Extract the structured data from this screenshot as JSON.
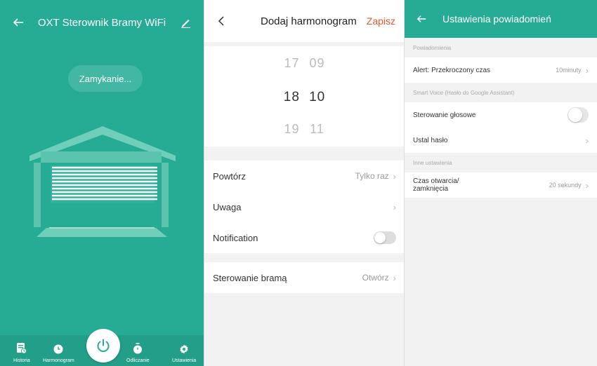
{
  "colors": {
    "accent": "#26ac95",
    "save": "#e55a2b"
  },
  "controller": {
    "title": "OXT Sterownik Bramy WiFi",
    "status": "Zamykanie...",
    "nav": [
      {
        "label": "Historia",
        "icon": "history-icon"
      },
      {
        "label": "Harmonogram",
        "icon": "clock-icon"
      },
      {
        "label": "Odliczanie",
        "icon": "timer-icon"
      },
      {
        "label": "Ustawienia",
        "icon": "gear-icon"
      }
    ]
  },
  "schedule": {
    "title": "Dodaj harmonogram",
    "save_label": "Zapisz",
    "picker": {
      "above": [
        "17",
        "09"
      ],
      "selected": [
        "18",
        "10"
      ],
      "below": [
        "19",
        "11"
      ]
    },
    "repeat_label": "Powtórz",
    "repeat_value": "Tylko raz",
    "note_label": "Uwaga",
    "notification_label": "Notification",
    "gate_label": "Sterowanie bramą",
    "gate_value": "Otwórz"
  },
  "notifications": {
    "title": "Ustawienia powiadomień",
    "section1": "Powiadomienia",
    "alert_label": "Alert: Przekroczony czas",
    "alert_value": "10minuty",
    "section2": "Smart Voice (Hasło do Google Assistant)",
    "voice_label": "Sterowanie głosowe",
    "password_label": "Ustal hasło",
    "section3": "Inne ustawienia",
    "time_label_1": "Czas otwarcia/",
    "time_label_2": "zamknięcia",
    "time_value": "20 sekundy"
  }
}
